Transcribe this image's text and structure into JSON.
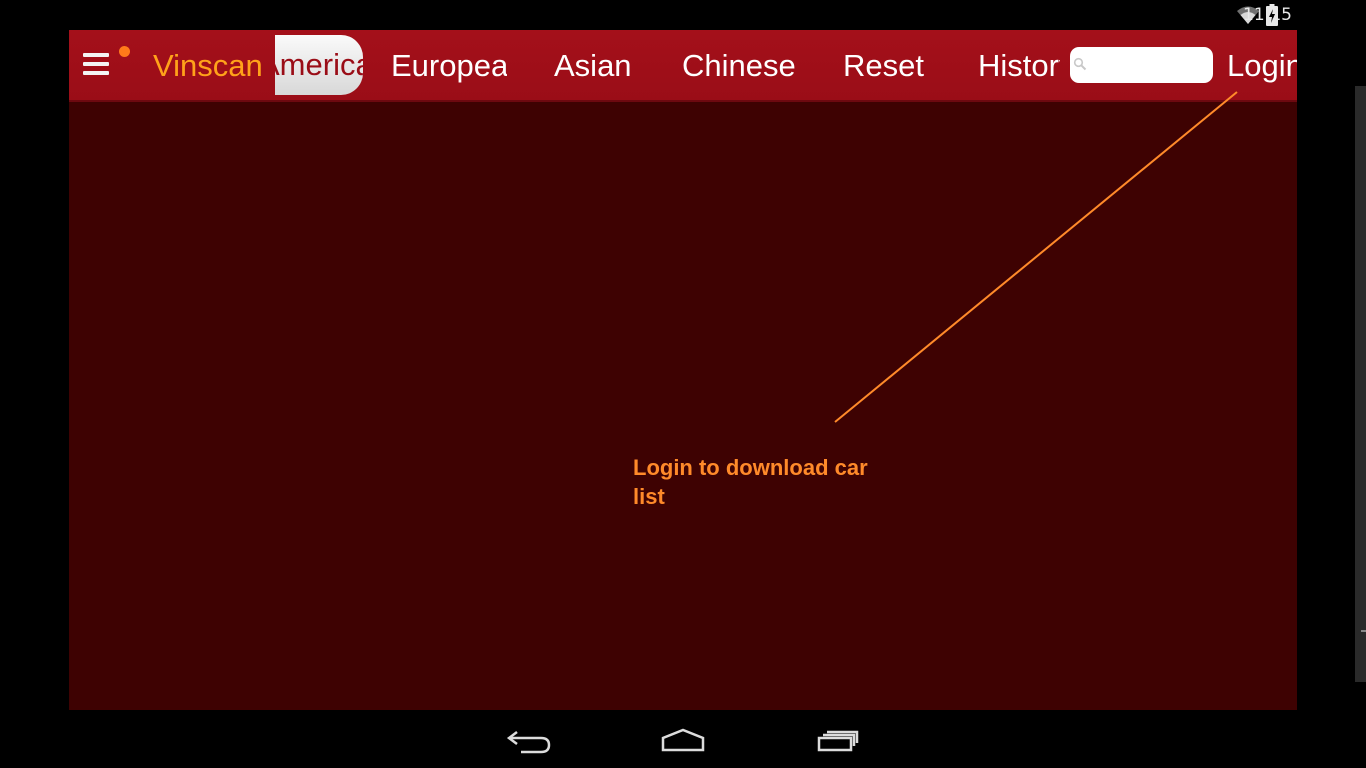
{
  "status_bar": {
    "time": "11:15",
    "icons": [
      "wifi-icon",
      "battery-charging-icon"
    ]
  },
  "app": {
    "brand": "Vinscan",
    "tabs": [
      {
        "label": "America",
        "active": true
      },
      {
        "label": "European",
        "active": false
      },
      {
        "label": "Asian",
        "active": false
      },
      {
        "label": "Chinese",
        "active": false
      },
      {
        "label": "Reset",
        "active": false
      },
      {
        "label": "History",
        "active": false
      }
    ],
    "search": {
      "placeholder": "",
      "value": ""
    },
    "login_label": "Login",
    "hint": "Login to download car list"
  },
  "nav_bar": {
    "buttons": [
      "back-icon",
      "home-icon",
      "recent-apps-icon"
    ]
  },
  "colors": {
    "top_bar": "#a4101a",
    "content_bg": "#3e0202",
    "brand": "#ffa21a",
    "hint": "#ff8a2a"
  }
}
